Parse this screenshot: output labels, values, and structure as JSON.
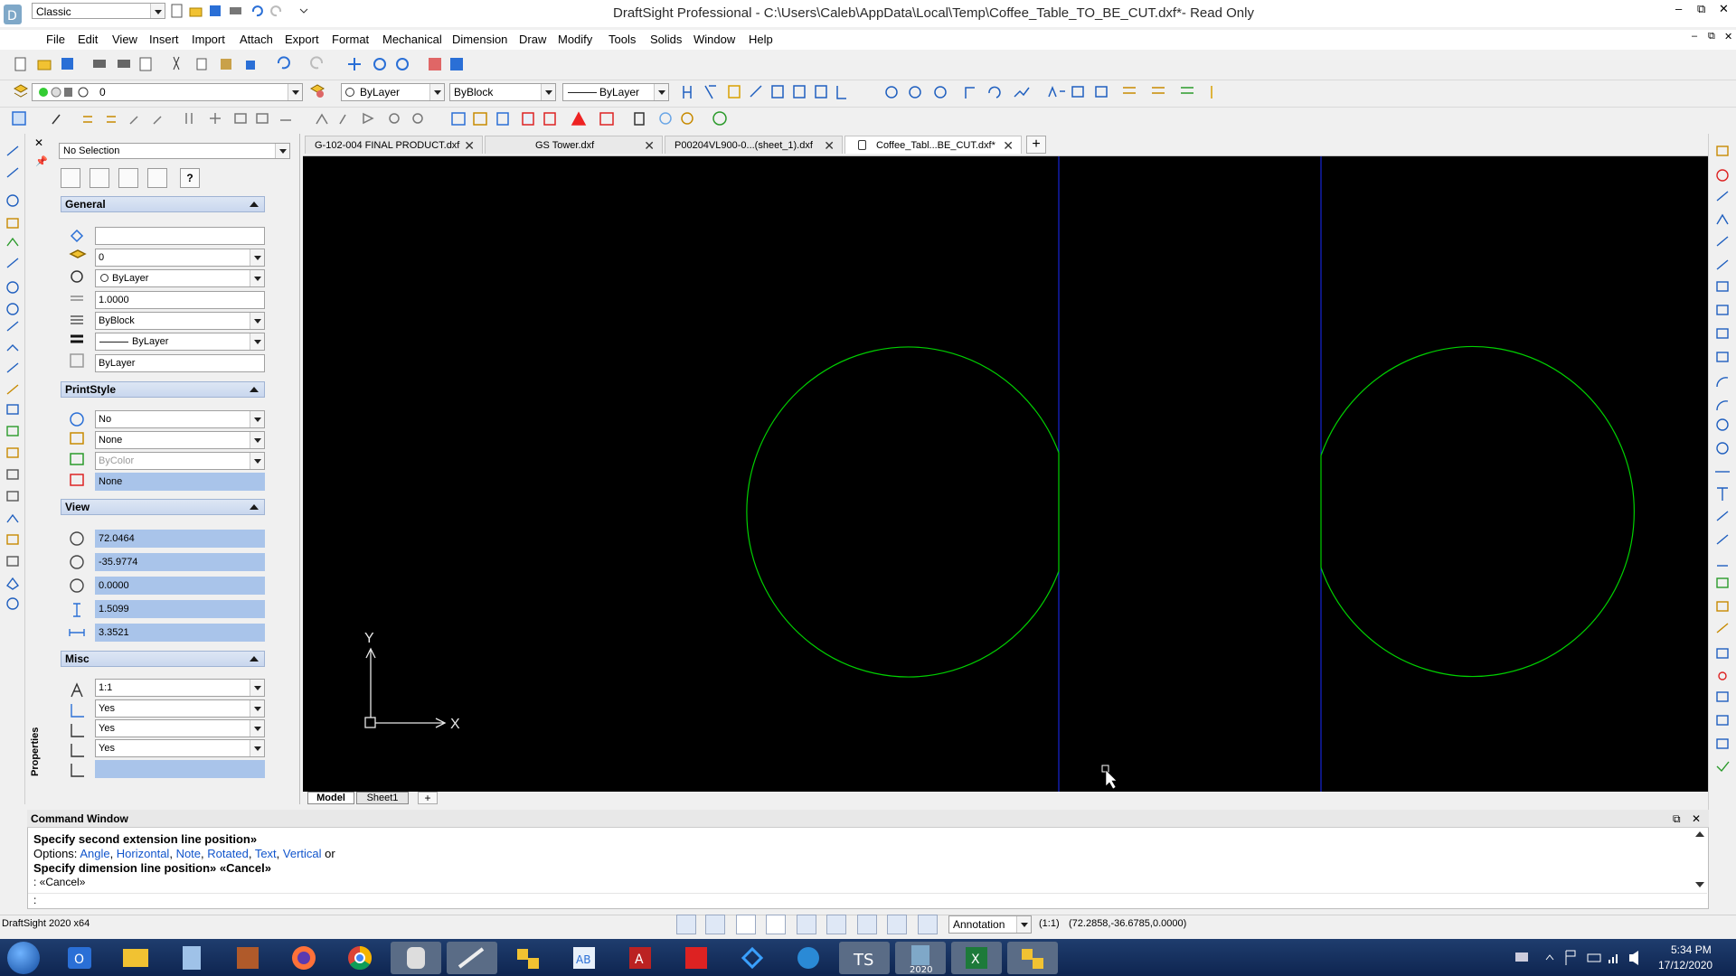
{
  "title_bar": {
    "workspace": "Classic",
    "title": "DraftSight Professional - C:\\Users\\Caleb\\AppData\\Local\\Temp\\Coffee_Table_TO_BE_CUT.dxf*- Read Only"
  },
  "menu": [
    "File",
    "Edit",
    "View",
    "Insert",
    "Import",
    "Attach",
    "Export",
    "Format",
    "Mechanical",
    "Dimension",
    "Draw",
    "Modify",
    "Tools",
    "Solids",
    "Window",
    "Help"
  ],
  "layer_toolbar": {
    "layer": "0",
    "color": "ByLayer",
    "linestyle": "ByBlock",
    "lineweight": "ByLayer"
  },
  "properties": {
    "selection": "No Selection",
    "panel_label": "Properties",
    "general": {
      "title": "General",
      "fields": [
        "",
        "0",
        "ByLayer",
        "1.0000",
        "ByBlock",
        "ByLayer",
        "ByLayer"
      ]
    },
    "printstyle": {
      "title": "PrintStyle",
      "fields": [
        "No",
        "None",
        "ByColor",
        "None"
      ]
    },
    "view": {
      "title": "View",
      "fields": [
        "72.0464",
        "-35.9774",
        "0.0000",
        "1.5099",
        "3.3521"
      ]
    },
    "misc": {
      "title": "Misc",
      "fields": [
        "1:1",
        "Yes",
        "Yes",
        "Yes",
        ""
      ]
    }
  },
  "tabs": [
    {
      "label": "G-102-004 FINAL PRODUCT.dxf",
      "active": false
    },
    {
      "label": "GS Tower.dxf",
      "active": false
    },
    {
      "label": "P00204VL900-0...(sheet_1).dxf",
      "active": false
    },
    {
      "label": "Coffee_Tabl...BE_CUT.dxf*",
      "active": true
    }
  ],
  "layout_tabs": [
    "Model",
    "Sheet1"
  ],
  "canvas": {
    "axis_x": "X",
    "axis_y": "Y",
    "geometry_color": "#00d000",
    "guide_color": "#1a2cff",
    "background": "#000000"
  },
  "command_window": {
    "title": "Command Window",
    "line1": "Specify second extension line position»",
    "options_prefix": "Options: ",
    "options": [
      "Angle",
      "Horizontal",
      "Note",
      "Rotated",
      "Text",
      "Vertical"
    ],
    "options_suffix": " or",
    "line3": "Specify dimension line position» «Cancel»",
    "line4": ": «Cancel»",
    "prompt": ":"
  },
  "status_bar": {
    "app": "DraftSight 2020 x64",
    "annotation": "Annotation",
    "scale": "(1:1)",
    "coords": "(72.2858,-36.6785,0.0000)"
  },
  "taskbar": {
    "time": "5:34 PM",
    "date": "17/12/2020",
    "apps": [
      "outlook",
      "explorer",
      "calculator",
      "sketch-game",
      "firefox",
      "chrome",
      "app-grey",
      "draw-pen",
      "autodesk",
      "word-ab",
      "access",
      "solidworks",
      "vsc",
      "speed",
      "ts",
      "draftsight",
      "excel",
      "autodesk2"
    ]
  }
}
